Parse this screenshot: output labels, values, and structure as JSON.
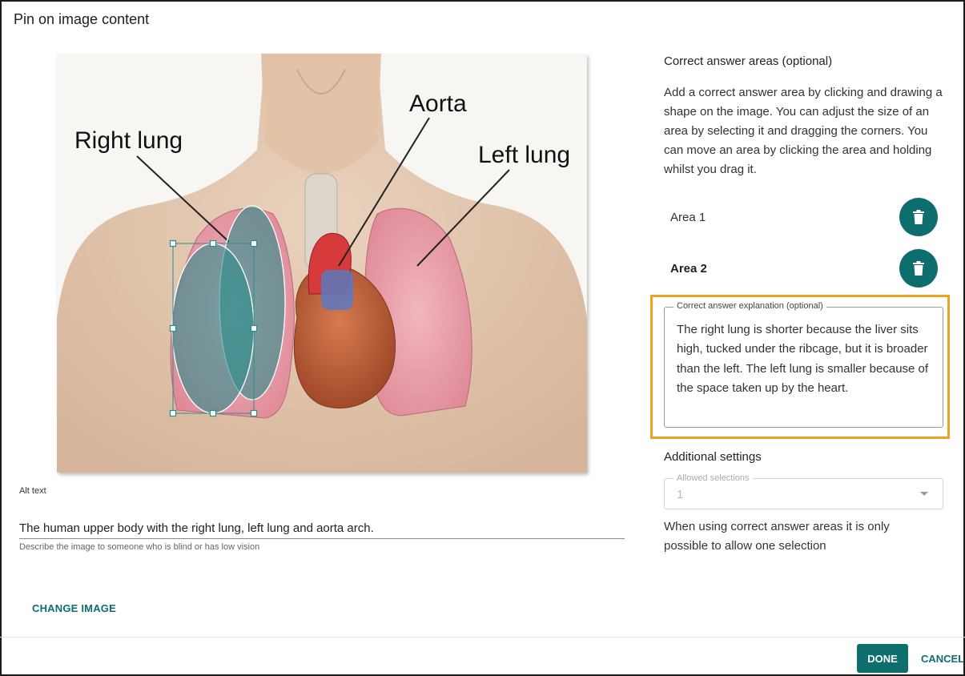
{
  "dialog": {
    "title": "Pin on image content"
  },
  "image": {
    "labels": {
      "right_lung": "Right lung",
      "aorta": "Aorta",
      "left_lung": "Left lung"
    }
  },
  "alt_text": {
    "label": "Alt text",
    "value": "The human upper body with the right lung, left lung and aorta arch.",
    "help": "Describe the image to someone who is blind or has low vision"
  },
  "change_image_label": "CHANGE IMAGE",
  "answer_areas": {
    "title": "Correct answer areas (optional)",
    "description": "Add a correct answer area by clicking and drawing a shape on the image. You can adjust the size of an area by selecting it and dragging the corners. You can move an area by clicking the area and holding whilst you drag it.",
    "areas": [
      {
        "label": "Area 1",
        "selected": false
      },
      {
        "label": "Area 2",
        "selected": true
      }
    ]
  },
  "explanation": {
    "legend": "Correct answer explanation (optional)",
    "value": "The right lung is shorter because the liver sits high, tucked under the ribcage, but it is broader than the left. The left lung is smaller because of the space taken up by the heart."
  },
  "additional_settings": {
    "title": "Additional settings",
    "allowed_selections_label": "Allowed selections",
    "allowed_selections_value": "1",
    "note": "When using correct answer areas it is only possible to allow one selection"
  },
  "footer": {
    "done_label": "DONE",
    "cancel_label": "CANCEL"
  },
  "colors": {
    "accent": "#0e6e6e",
    "highlight": "#f0a21f",
    "area_fill": "#2e8c8c"
  }
}
